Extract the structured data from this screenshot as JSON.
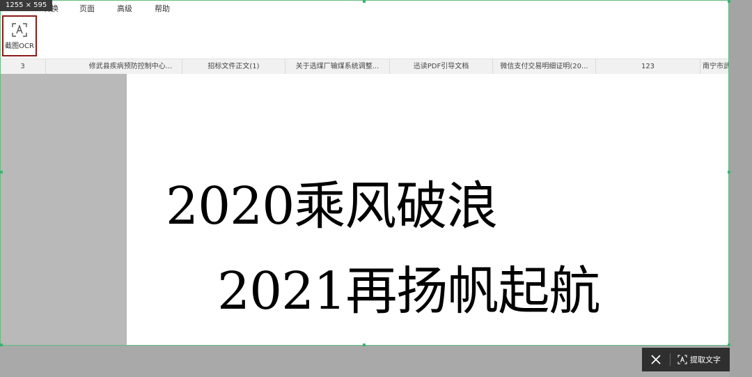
{
  "size_badge": "1255 × 595",
  "menu": [
    "转换",
    "页面",
    "高级",
    "帮助"
  ],
  "ribbon": {
    "ocr_button_label": "截图OCR"
  },
  "tabs": [
    "3",
    "修武县疾病预防控制中心...",
    "招标文件正文(1)",
    "关于选煤厂输煤系统调整...",
    "迅读PDF引导文档",
    "微信支付交易明细证明(20...",
    "123",
    "南宁市武鸣区两"
  ],
  "document": {
    "line1": "2020乘风破浪",
    "line2": "2021再扬帆起航"
  },
  "action_bar": {
    "extract_label": "提取文字"
  },
  "colors": {
    "selection_border": "#5fbf7f",
    "ocr_highlight": "#8b1a1a",
    "action_bar_bg": "#2f2f2f"
  }
}
